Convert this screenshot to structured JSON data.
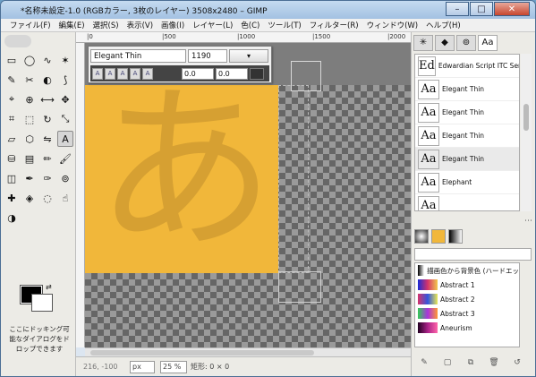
{
  "window": {
    "title": "*名称未設定-1.0 (RGBカラー, 3枚のレイヤー) 3508x2480 – GIMP",
    "minimize": "–",
    "maximize": "□",
    "close": "✕"
  },
  "menu": [
    "ファイル(F)",
    "編集(E)",
    "選択(S)",
    "表示(V)",
    "画像(I)",
    "レイヤー(L)",
    "色(C)",
    "ツール(T)",
    "フィルター(R)",
    "ウィンドウ(W)",
    "ヘルプ(H)"
  ],
  "ruler": {
    "ticks": [
      "|0",
      "|500",
      "|1000",
      "|1500",
      "|2000"
    ]
  },
  "toolbox": {
    "tools": [
      {
        "icon": "▭",
        "name": "rect-select-icon"
      },
      {
        "icon": "◯",
        "name": "ellipse-select-icon"
      },
      {
        "icon": "∿",
        "name": "free-select-icon"
      },
      {
        "icon": "✶",
        "name": "fuzzy-select-icon"
      },
      {
        "icon": "✎",
        "name": "select-by-color-icon"
      },
      {
        "icon": "✂",
        "name": "scissors-icon"
      },
      {
        "icon": "◐",
        "name": "foreground-select-icon"
      },
      {
        "icon": "⟆",
        "name": "paths-icon"
      },
      {
        "icon": "⌖",
        "name": "color-picker-icon"
      },
      {
        "icon": "⊕",
        "name": "zoom-icon"
      },
      {
        "icon": "⟷",
        "name": "measure-icon"
      },
      {
        "icon": "✥",
        "name": "move-icon"
      },
      {
        "icon": "⌗",
        "name": "align-icon"
      },
      {
        "icon": "⬚",
        "name": "crop-icon"
      },
      {
        "icon": "↻",
        "name": "rotate-icon"
      },
      {
        "icon": "⤡",
        "name": "scale-icon"
      },
      {
        "icon": "▱",
        "name": "shear-icon"
      },
      {
        "icon": "⬡",
        "name": "perspective-icon"
      },
      {
        "icon": "⇋",
        "name": "flip-icon"
      },
      {
        "icon": "A",
        "name": "text-tool-icon"
      },
      {
        "icon": "⛁",
        "name": "bucket-fill-icon"
      },
      {
        "icon": "▤",
        "name": "blend-icon"
      },
      {
        "icon": "✏",
        "name": "pencil-icon"
      },
      {
        "icon": "🖌",
        "name": "paintbrush-icon"
      },
      {
        "icon": "◫",
        "name": "eraser-icon"
      },
      {
        "icon": "✒",
        "name": "airbrush-icon"
      },
      {
        "icon": "✑",
        "name": "ink-icon"
      },
      {
        "icon": "⊚",
        "name": "clone-icon"
      },
      {
        "icon": "✚",
        "name": "heal-icon"
      },
      {
        "icon": "◈",
        "name": "perspective-clone-icon"
      },
      {
        "icon": "◌",
        "name": "blur-icon"
      },
      {
        "icon": "☝",
        "name": "smudge-icon"
      },
      {
        "icon": "◑",
        "name": "dodge-burn-icon"
      }
    ],
    "selected_tool_index": 19,
    "swap_icon": "⇄",
    "dock_hint": "ここにドッキング可能なダイアログをドロップできます"
  },
  "text_editor": {
    "font": "Elegant Thin",
    "size": "1190",
    "unit": "▾",
    "style_buttons": [
      "A",
      "A",
      "A",
      "A",
      "A"
    ],
    "baseline": "0.0",
    "kerning": "0.0"
  },
  "canvas": {
    "glyph": "あ",
    "image_color": "#f1b73a"
  },
  "statusbar": {
    "coords": "216, -100",
    "unit": "px",
    "zoom": "25 %",
    "message": "矩形: 0 × 0"
  },
  "dock": {
    "tab_icons": [
      "✳",
      "◆",
      "⊚",
      "Aa"
    ],
    "fonts": [
      {
        "preview": "Ed",
        "name": "Edwardian Script ITC Semi"
      },
      {
        "preview": "Aa",
        "name": "Elegant Thin"
      },
      {
        "preview": "Aa",
        "name": "Elegant Thin"
      },
      {
        "preview": "Aa",
        "name": "Elegant Thin"
      },
      {
        "preview": "Aa",
        "name": "Elegant Thin"
      },
      {
        "preview": "Aa",
        "name": "Elephant"
      },
      {
        "preview": "Aa",
        "name": ""
      }
    ],
    "highlighted_font_index": 4,
    "gradients": [
      {
        "name": "描画色から背景色 (ハードエッ",
        "colors": [
          "#000000",
          "#ffffff"
        ]
      },
      {
        "name": "Abstract 1",
        "colors": [
          "#1a2bd6",
          "#d6336a",
          "#f2c94c"
        ]
      },
      {
        "name": "Abstract 2",
        "colors": [
          "#d6336a",
          "#3355dd",
          "#e8e855"
        ]
      },
      {
        "name": "Abstract 3",
        "colors": [
          "#33cc55",
          "#aa33dd",
          "#ff9933"
        ]
      },
      {
        "name": "Aneurism",
        "colors": [
          "#220022",
          "#aa2288",
          "#ff66aa"
        ]
      }
    ],
    "footer_icons": [
      "✎",
      "▢",
      "⧉",
      "🗑",
      "↺"
    ]
  }
}
